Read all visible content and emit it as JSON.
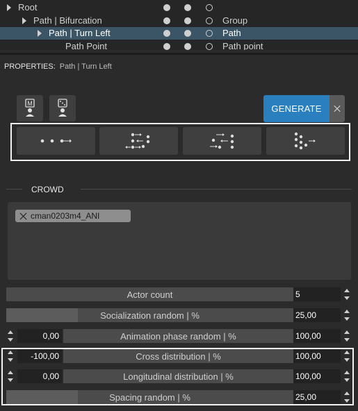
{
  "tree": {
    "rows": [
      {
        "label": "Root",
        "type": ""
      },
      {
        "label": "Path | Bifurcation",
        "type": "Group"
      },
      {
        "label": "Path | Turn Left",
        "type": "Path"
      },
      {
        "label": "Path Point",
        "type": "Path point"
      }
    ]
  },
  "properties": {
    "label": "PROPERTIES:",
    "path": "Path | Turn Left"
  },
  "toolbar": {
    "icons": [
      "m-badge-user-icon",
      "dice-user-icon"
    ],
    "generate_label": "GENERATE",
    "patterns": [
      "dots-line-pattern-icon",
      "dots-swap-pattern-icon",
      "dots-reverse-pattern-icon",
      "dots-cluster-pattern-icon"
    ]
  },
  "crowd": {
    "title": "CROWD",
    "actors": [
      "cman0203m4_ANI"
    ]
  },
  "params": [
    {
      "label": "Actor count",
      "value": "5",
      "fill": 0.0
    },
    {
      "label": "Socialization random | %",
      "value": "25,00",
      "fill": 0.25
    },
    {
      "label": "Animation phase random | %",
      "min": "0,00",
      "value": "100,00",
      "fill": 0.0
    },
    {
      "label": "Cross distribution | %",
      "min": "-100,00",
      "value": "100,00",
      "fill": 0.0
    },
    {
      "label": "Longitudinal distribution | %",
      "min": "0,00",
      "value": "100,00",
      "fill": 0.0
    },
    {
      "label": "Spacing random | %",
      "value": "25,00",
      "fill": 0.25
    }
  ],
  "colors": {
    "accent": "#2a7fbf",
    "selection": "#3c5566",
    "background": "#2b2b2b"
  }
}
